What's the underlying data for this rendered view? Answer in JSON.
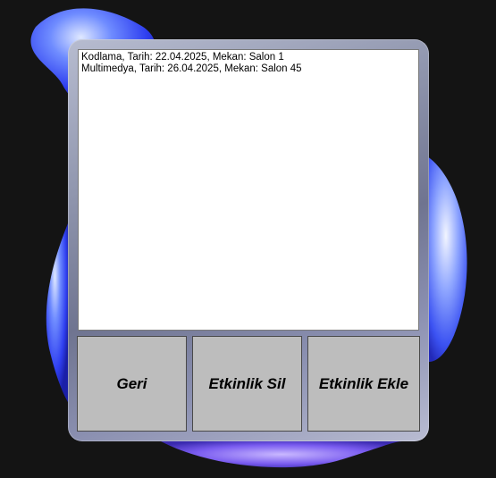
{
  "events_list": {
    "items": [
      "Kodlama, Tarih: 22.04.2025, Mekan: Salon 1",
      "Multimedya, Tarih: 26.04.2025, Mekan: Salon 45"
    ]
  },
  "buttons": {
    "back_label": "Geri",
    "delete_label": "Etkinlik Sil",
    "add_label": "Etkinlik Ekle"
  },
  "colors": {
    "background": "#141414",
    "listbox": "#ffffff",
    "button_face": "#bdbdbd",
    "blob_blue": "#3a5cff"
  }
}
